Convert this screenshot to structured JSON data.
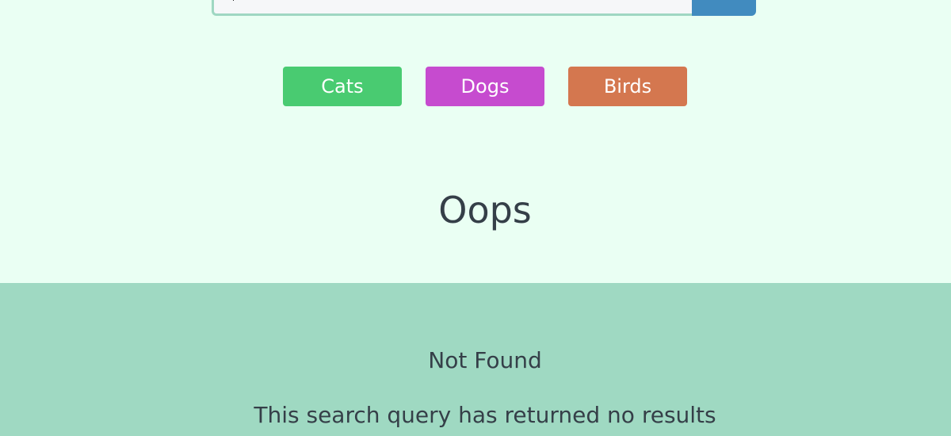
{
  "search": {
    "value": "",
    "button_color": "#418bbf",
    "border_color": "#9fd7c2"
  },
  "categories": [
    {
      "label": "Cats",
      "color": "#49cb71"
    },
    {
      "label": "Dogs",
      "color": "#c64bcf"
    },
    {
      "label": "Birds",
      "color": "#d4774f"
    }
  ],
  "message": {
    "heading": "Oops",
    "subheading": "Not Found",
    "detail": "This search query has returned no results"
  },
  "colors": {
    "page_background": "#eafff3",
    "panel_background": "#9fd9c2",
    "text": "#353f48"
  }
}
